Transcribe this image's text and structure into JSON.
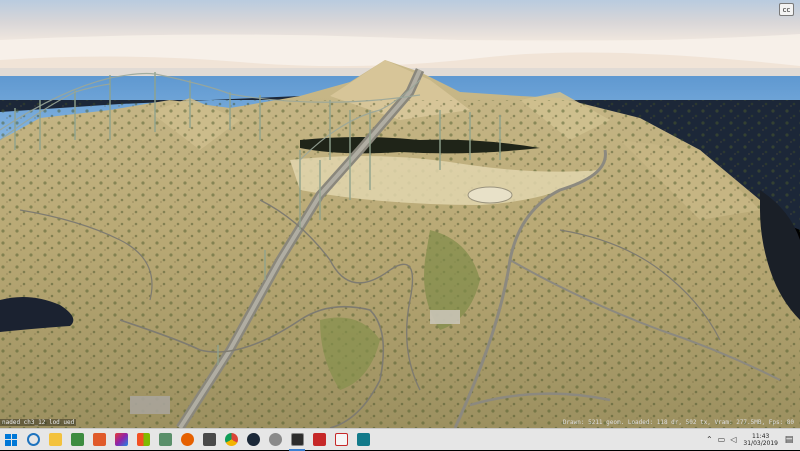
{
  "viewer": {
    "corner_button_label": "cc",
    "status_text": "naded ch3_12 lod ued",
    "stats_text": "Drawn: 5211 geom. Loaded: 118 dr, 502 tx, Vram: 277.5MB, Fps: 80"
  },
  "taskbar": {
    "apps": [
      {
        "name": "ie",
        "color": "#1e73be"
      },
      {
        "name": "file-explorer",
        "color": "#f3c23d"
      },
      {
        "name": "store",
        "color": "#3d8c40"
      },
      {
        "name": "media-player",
        "color": "#e05a2a"
      },
      {
        "name": "paint",
        "color": "#b0348a"
      },
      {
        "name": "windows-apps",
        "color": "#1565c0"
      },
      {
        "name": "3d-app",
        "color": "#5a8f6a"
      },
      {
        "name": "firefox",
        "color": "#e66000"
      },
      {
        "name": "settings",
        "color": "#4a4a4a"
      },
      {
        "name": "chrome",
        "color": "#4caf50"
      },
      {
        "name": "steam",
        "color": "#1b2838"
      },
      {
        "name": "xbox",
        "color": "#8a8a8a"
      },
      {
        "name": "codewalker",
        "color": "#2d2d2d"
      },
      {
        "name": "game-red",
        "color": "#c62828"
      },
      {
        "name": "reader",
        "color": "#d8d8d8"
      },
      {
        "name": "terminal",
        "color": "#127a8a"
      }
    ],
    "clock": {
      "time": "11:43",
      "date": "31/03/2019"
    }
  }
}
